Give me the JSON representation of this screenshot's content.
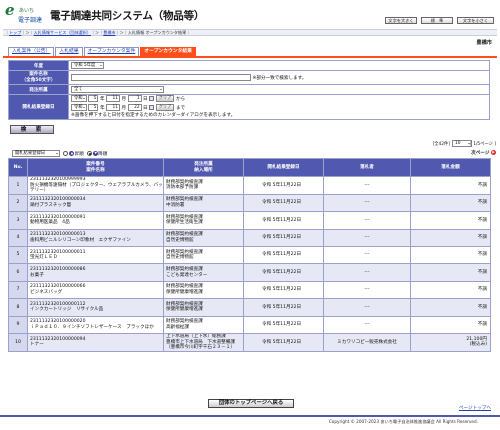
{
  "header": {
    "logo_glyph": "e",
    "logo_line1": "あいち",
    "logo_line2": "電子調達",
    "title": "電子調達共同システム（物品等）",
    "buttons": {
      "font_large": "文字を大きく",
      "font_standard": "標　準",
      "font_small": "文字を小さく"
    }
  },
  "breadcrumb": {
    "top": "トップ",
    "service": "入札情報サービス（団体選択）",
    "org": "豊橋市",
    "current": "入札情報 オープンカウンタ結果"
  },
  "org_name": "豊橋市",
  "tabs": [
    "入札案件（公告）",
    "入札結果",
    "オープンカウンタ案件",
    "オープンカウンタ結果"
  ],
  "search": {
    "year_label": "年度",
    "year_value": "令和 5年度",
    "name_label": "案件名称\n（全角50文字）",
    "name_value": "",
    "name_note": "※部分一致で検索します。",
    "dept_label": "発注所属",
    "dept_value": "全て",
    "date_label": "開札結果登録日",
    "era": "令和",
    "from": {
      "year": "5",
      "month": "11",
      "day": "1"
    },
    "to": {
      "year": "5",
      "month": "11",
      "day": "22"
    },
    "year_unit": "年",
    "month_unit": "月",
    "day_unit": "日",
    "clear": "クリア",
    "from_suffix": "から",
    "to_suffix": "まで",
    "calendar_note": "※画像を押下すると日付を指定するためのカレンダーダイアログを表示します。",
    "submit": "検　索"
  },
  "result_meta": {
    "count": "[全42件]",
    "per_page": "10",
    "pages": "[ 1/5ページ ]",
    "next": "次ページ",
    "next_icon": "▶"
  },
  "sort": {
    "field": "開札結果登録日",
    "asc": "昇順",
    "desc": "降順",
    "asc_icon": "▲",
    "desc_icon": "▼"
  },
  "table": {
    "headers": {
      "no": "No.",
      "case": "案件番号\n案件名称",
      "dept": "発注所属\n納入場所",
      "date": "開札結果登録日",
      "winner": "落札者",
      "amount": "落札金額"
    },
    "rows": [
      {
        "no": "1",
        "num": "2311132320100999993",
        "name": "防火損機等遠隔材（プロジェクター、ウェアラブルカメラ、バッテリー）",
        "dept": "財務部契約検査課",
        "place": "消防本部予防課",
        "date": "令和 5年11月22日",
        "winner": "---",
        "amount": "不調"
      },
      {
        "no": "2",
        "num": "2311132320100000034",
        "name": "鍋付プラスチック鬘",
        "dept": "財務部契約検査課",
        "place": "中消防署",
        "date": "令和 5年11月22日",
        "winner": "---",
        "amount": "不調"
      },
      {
        "no": "3",
        "num": "2311132320100000091",
        "name": "動物用医薬品　4品",
        "dept": "財務部契約検査課",
        "place": "保健所生活衛生課",
        "date": "令和 5年11月22日",
        "winner": "---",
        "amount": "不調"
      },
      {
        "no": "4",
        "num": "2311132320100000013",
        "name": "歯科用ビニルシリコーン印象材　エクザファイン",
        "dept": "財務部契約検査課",
        "place": "自然史博物館",
        "date": "令和 5年11月22日",
        "winner": "---",
        "amount": "不調"
      },
      {
        "no": "5",
        "num": "2311132320100000011",
        "name": "蛍光灯ＬＥＤ",
        "dept": "財務部契約検査課",
        "place": "自然史博物館",
        "date": "令和 5年11月22日",
        "winner": "---",
        "amount": "不調"
      },
      {
        "no": "6",
        "num": "2311132320100000086",
        "name": "お菓子",
        "dept": "財務部契約検査課",
        "place": "こども発達センター",
        "date": "令和 5年11月22日",
        "winner": "---",
        "amount": "不調"
      },
      {
        "no": "7",
        "num": "2311132320100000066",
        "name": "ビジネスバッグ",
        "dept": "財務部契約検査課",
        "place": "保健所健康増進課",
        "date": "令和 5年11月22日",
        "winner": "---",
        "amount": "不調"
      },
      {
        "no": "8",
        "num": "2311132320100000112",
        "name": "インクカートリッジ　リサイクル品",
        "dept": "財務部契約検査課",
        "place": "保健所健康増進課",
        "date": "令和 5年11月22日",
        "winner": "---",
        "amount": "不調"
      },
      {
        "no": "9",
        "num": "2311132320100000020",
        "name": "ｉＰａｄ１０．９インチソフトレザーケース　ブラックほか",
        "dept": "財務部契約検査課",
        "place": "高齢福祉課",
        "date": "令和 5年11月22日",
        "winner": "---",
        "amount": "不調"
      },
      {
        "no": "10",
        "num": "2311132320100000094",
        "name": "トナー",
        "dept": "上下水道局（上下水）総務課",
        "place": "豊橋市上下水道局　下水道整備課（豊橋市今川町字千石２３－１）",
        "date": "令和 5年11月22日",
        "winner": "ミカワリコピー販売株式会社",
        "amount": "21,100円\n(税込み)"
      }
    ]
  },
  "bottom": {
    "top_back": "団体のトップページへ戻る",
    "page_top": "ページトップへ"
  },
  "footer": {
    "copyright": "Copyright © 2007-2023 あいち電子自治体推進協議会 All Rights Reserved."
  },
  "colors": {
    "accent": "#ff4e1a",
    "header_bg": "#5058b0",
    "row_alt": "#e6e8f5"
  }
}
